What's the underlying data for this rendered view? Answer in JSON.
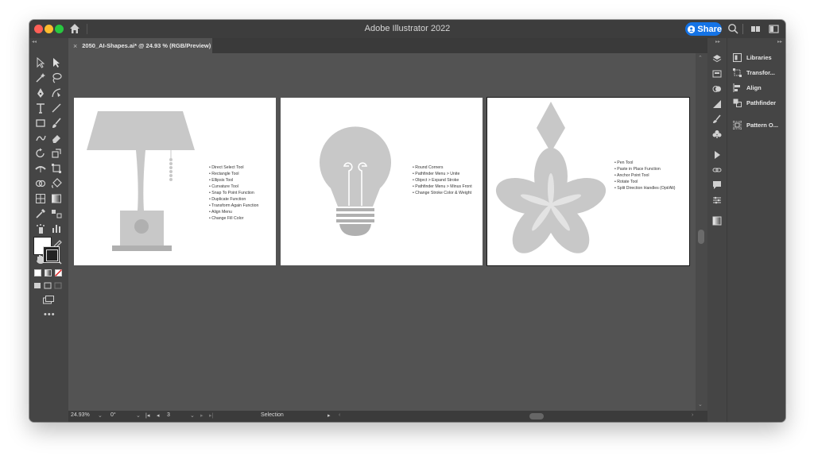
{
  "window": {
    "title": "Adobe Illustrator 2022"
  },
  "share": {
    "label": "Share"
  },
  "document_tab": {
    "label": "2050_AI-Shapes.ai* @ 24.93 % (RGB/Preview)"
  },
  "artboards": [
    {
      "bullets": [
        "Direct Select Tool",
        "Rectangle Tool",
        "Ellipsis Tool",
        "Curvature Tool",
        "Snap To Point Function",
        "Duplicate Function",
        "Transform Again Function",
        "Align Menu",
        "Change Fill Color"
      ]
    },
    {
      "bullets": [
        "Round Corners",
        "Pathfinder Menu > Unite",
        "Object > Expand Stroke",
        "Pathfinder Menu > Minus Front",
        "Change Stroke Color & Weight"
      ]
    },
    {
      "bullets": [
        "Pen Tool",
        "Paste in Place Function",
        "Anchor Point Tool",
        "Rotate Tool",
        "Split Direction Handles (Opt/Alt)"
      ]
    }
  ],
  "status": {
    "zoom": "24.93%",
    "rotation": "0°",
    "artboard": "3",
    "mode": "Selection"
  },
  "panels": [
    {
      "label": "Libraries",
      "icon": "libraries-icon"
    },
    {
      "label": "Transfor...",
      "icon": "transform-icon"
    },
    {
      "label": "Align",
      "icon": "align-icon"
    },
    {
      "label": "Pathfinder",
      "icon": "pathfinder-icon"
    },
    {
      "label": "Pattern O...",
      "icon": "pattern-options-icon"
    }
  ],
  "colors": {
    "canvas": "#535353",
    "panel": "#454545",
    "accent": "#1473e6",
    "shape": "#c8c8c8"
  }
}
